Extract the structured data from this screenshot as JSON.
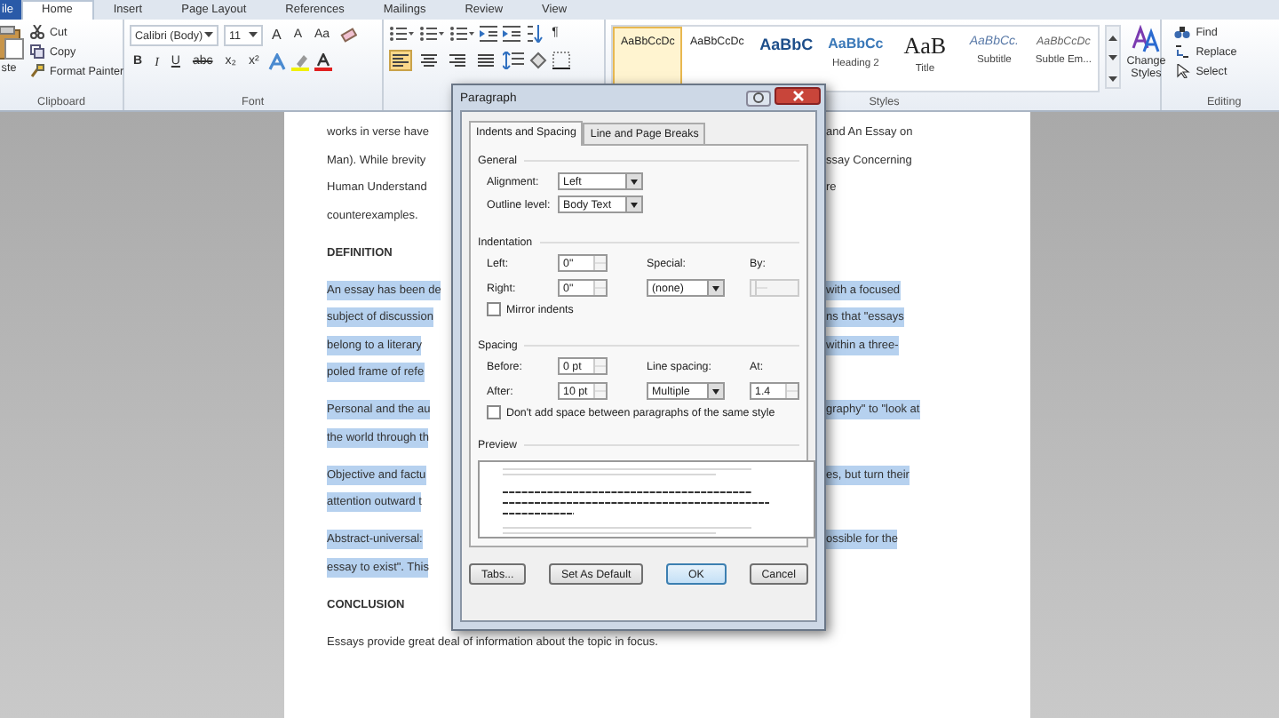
{
  "ribbon": {
    "file_tab": "ile",
    "tabs": [
      {
        "label": "Home",
        "selected": true
      },
      {
        "label": "Insert",
        "selected": false
      },
      {
        "label": "Page Layout",
        "selected": false
      },
      {
        "label": "References",
        "selected": false
      },
      {
        "label": "Mailings",
        "selected": false
      },
      {
        "label": "Review",
        "selected": false
      },
      {
        "label": "View",
        "selected": false
      }
    ],
    "clipboard": {
      "paste": "ste",
      "cut": "Cut",
      "copy": "Copy",
      "format_painter": "Format Painter",
      "label": "Clipboard"
    },
    "font": {
      "family": "Calibri (Body)",
      "size": "11",
      "grow": "A",
      "shrink": "A",
      "change_case": "Aa",
      "format_buttons": [
        "B",
        "I",
        "U",
        "abc",
        "x₂",
        "x²"
      ],
      "label": "Font"
    },
    "paragraph": {
      "marks": "¶",
      "align": [
        {
          "kind": "left",
          "selected": true
        },
        {
          "kind": "center",
          "selected": false
        },
        {
          "kind": "right",
          "selected": false
        },
        {
          "kind": "justify",
          "selected": false
        }
      ]
    },
    "styles": {
      "items": [
        {
          "sample": "AaBbCcDc",
          "kind": "normal",
          "selected": true
        },
        {
          "sample": "AaBbCcDc",
          "kind": "normal",
          "selected": false
        },
        {
          "sample": "AaBbC",
          "kind": "heading1",
          "selected": false
        },
        {
          "sample": "AaBbCc",
          "kind": "heading2",
          "label": "Heading 2",
          "selected": false
        },
        {
          "sample": "AaB",
          "kind": "title",
          "label": "Title",
          "selected": false
        },
        {
          "sample": "AaBbCc.",
          "kind": "subtitle",
          "label": "Subtitle",
          "selected": false
        },
        {
          "sample": "AaBbCcDc",
          "kind": "emphasis",
          "label": "Subtle Em...",
          "selected": false
        }
      ],
      "change_styles": "Change Styles",
      "label": "Styles"
    },
    "editing": {
      "find": "Find",
      "replace": "Replace",
      "select": "Select",
      "label": "Editing"
    }
  },
  "document": {
    "paragraphs": [
      {
        "kind": "text",
        "selected": false,
        "lines": [
          {
            "left": "works in verse have",
            "right": "and An Essay on"
          },
          {
            "left": "Man). While brevity",
            "right": "ssay Concerning"
          },
          {
            "left": "Human Understand",
            "right": "re"
          },
          {
            "left": "counterexamples."
          }
        ]
      },
      {
        "kind": "heading",
        "selected": false,
        "lines": [
          {
            "left": "DEFINITION"
          }
        ]
      },
      {
        "kind": "text",
        "selected": true,
        "lines": [
          {
            "left": "An essay has been de",
            "right": "with a focused"
          },
          {
            "left": "subject of discussion",
            "right": "ns that \"essays"
          },
          {
            "left": "belong to a literary",
            "right": "within a three-"
          },
          {
            "left": "poled frame of refe"
          }
        ]
      },
      {
        "kind": "text",
        "selected": true,
        "lines": [
          {
            "left": "Personal and the au",
            "right": "graphy\" to \"look at"
          },
          {
            "left": "the world through th"
          }
        ]
      },
      {
        "kind": "text",
        "selected": true,
        "lines": [
          {
            "left": "Objective and factu",
            "right": "es, but turn their"
          },
          {
            "left": "attention outward t"
          }
        ]
      },
      {
        "kind": "text",
        "selected": true,
        "lines": [
          {
            "left": "Abstract-universal:",
            "right": "ossible for the"
          },
          {
            "left": "essay to exist\". This"
          }
        ]
      },
      {
        "kind": "heading",
        "selected": false,
        "lines": [
          {
            "left": "CONCLUSION"
          }
        ]
      },
      {
        "kind": "text",
        "selected": false,
        "lines": [
          {
            "full": "Essays provide great deal of information about the topic in focus."
          }
        ]
      }
    ]
  },
  "dialog": {
    "title": "Paragraph",
    "tabs": [
      {
        "label": "Indents and Spacing",
        "selected": true
      },
      {
        "label": "Line and Page Breaks",
        "selected": false
      }
    ],
    "general": {
      "heading": "General",
      "alignment_label": "Alignment:",
      "alignment": "Left",
      "outline_label": "Outline level:",
      "outline": "Body Text"
    },
    "indentation": {
      "heading": "Indentation",
      "left_label": "Left:",
      "left": "0\"",
      "right_label": "Right:",
      "right": "0\"",
      "special_label": "Special:",
      "special": "(none)",
      "by_label": "By:",
      "mirror_label": "Mirror indents",
      "mirror_checked": false
    },
    "spacing": {
      "heading": "Spacing",
      "before_label": "Before:",
      "before": "0 pt",
      "after_label": "After:",
      "after": "10 pt",
      "line_label": "Line spacing:",
      "line": "Multiple",
      "at_label": "At:",
      "at": "1.4",
      "dont_add_label": "Don't add space between paragraphs of the same style",
      "dont_add_checked": false
    },
    "preview": {
      "heading": "Preview"
    },
    "buttons": [
      {
        "label": "Tabs...",
        "kind": "normal"
      },
      {
        "label": "Set As Default",
        "kind": "normal"
      },
      {
        "label": "OK",
        "kind": "default"
      },
      {
        "label": "Cancel",
        "kind": "normal"
      }
    ]
  }
}
